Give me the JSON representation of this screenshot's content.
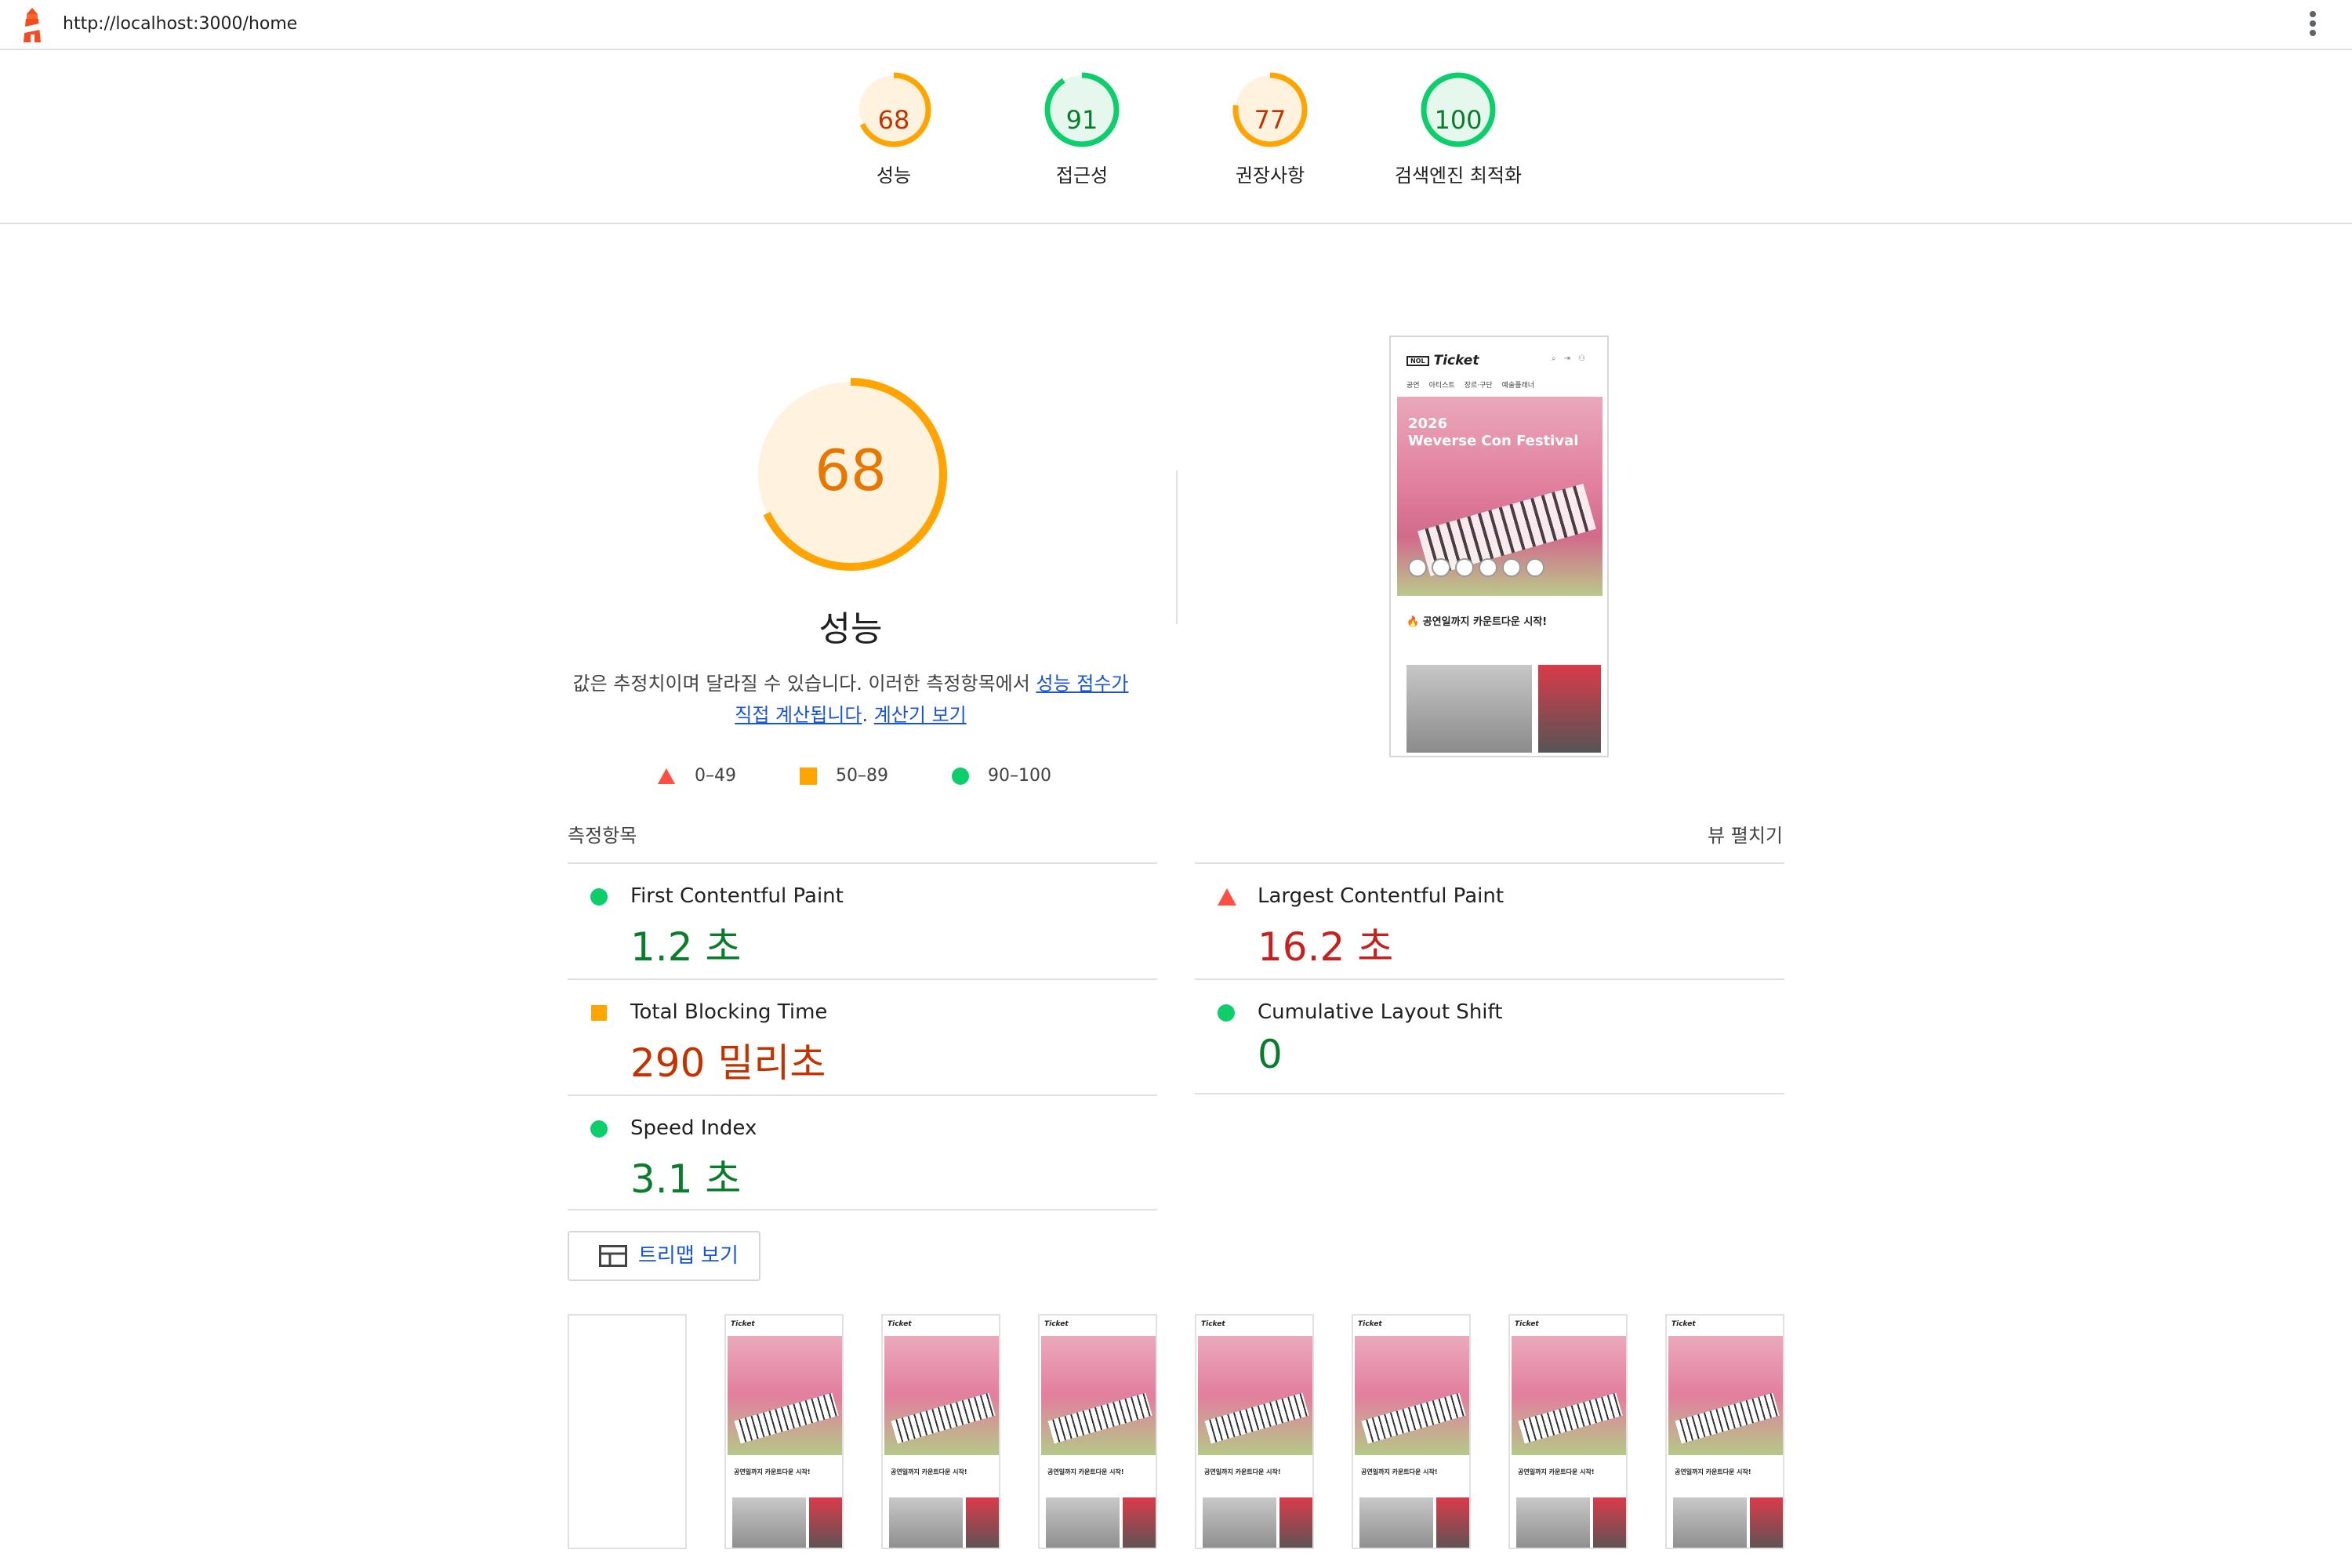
{
  "topbar": {
    "url": "http://localhost:3000/home"
  },
  "summary": [
    {
      "score": "68",
      "label": "성능",
      "value": 68,
      "color": "#ffa400"
    },
    {
      "score": "91",
      "label": "접근성",
      "value": 91,
      "color": "#0cce6b"
    },
    {
      "score": "77",
      "label": "권장사항",
      "value": 77,
      "color": "#ffa400"
    },
    {
      "score": "100",
      "label": "검색엔진 최적화",
      "value": 100,
      "color": "#0cce6b"
    }
  ],
  "performance": {
    "score": "68",
    "value": 68,
    "title": "성능",
    "desc_before": "값은 추정치이며 달라질 수 있습니다. 이러한 측정항목에서 ",
    "link1": "성능 점수가 직접 계산됩니다",
    "desc_mid": ". ",
    "link2": "계산기 보기"
  },
  "legend": [
    {
      "range": "0–49",
      "shape": "triangle",
      "color": "#ff4e42"
    },
    {
      "range": "50–89",
      "shape": "square",
      "color": "#ffa400"
    },
    {
      "range": "90–100",
      "shape": "circle",
      "color": "#0cce6b"
    }
  ],
  "screenshot": {
    "brand_box": "NOL",
    "brand": "Ticket",
    "nav": [
      "공연",
      "아티스트",
      "장르·구단",
      "예술플래너"
    ],
    "hero_title_1": "2026",
    "hero_title_2": "Weverse Con Festival",
    "section_title": "🔥 공연일까지 카운트다운 시작!"
  },
  "metrics": {
    "heading": "측정항목",
    "expand": "뷰 펼치기",
    "left": [
      {
        "name": "First Contentful Paint",
        "value": "1.2 초",
        "status": "good"
      },
      {
        "name": "Total Blocking Time",
        "value": "290 밀리초",
        "status": "average"
      },
      {
        "name": "Speed Index",
        "value": "3.1 초",
        "status": "good"
      }
    ],
    "right": [
      {
        "name": "Largest Contentful Paint",
        "value": "16.2 초",
        "status": "fail"
      },
      {
        "name": "Cumulative Layout Shift",
        "value": "0",
        "status": "good"
      }
    ]
  },
  "treemap": {
    "label": "트리맵 보기"
  },
  "filmstrip": {
    "brand": "Ticket",
    "caption": "공연일까지 카운트다운 시작!"
  }
}
